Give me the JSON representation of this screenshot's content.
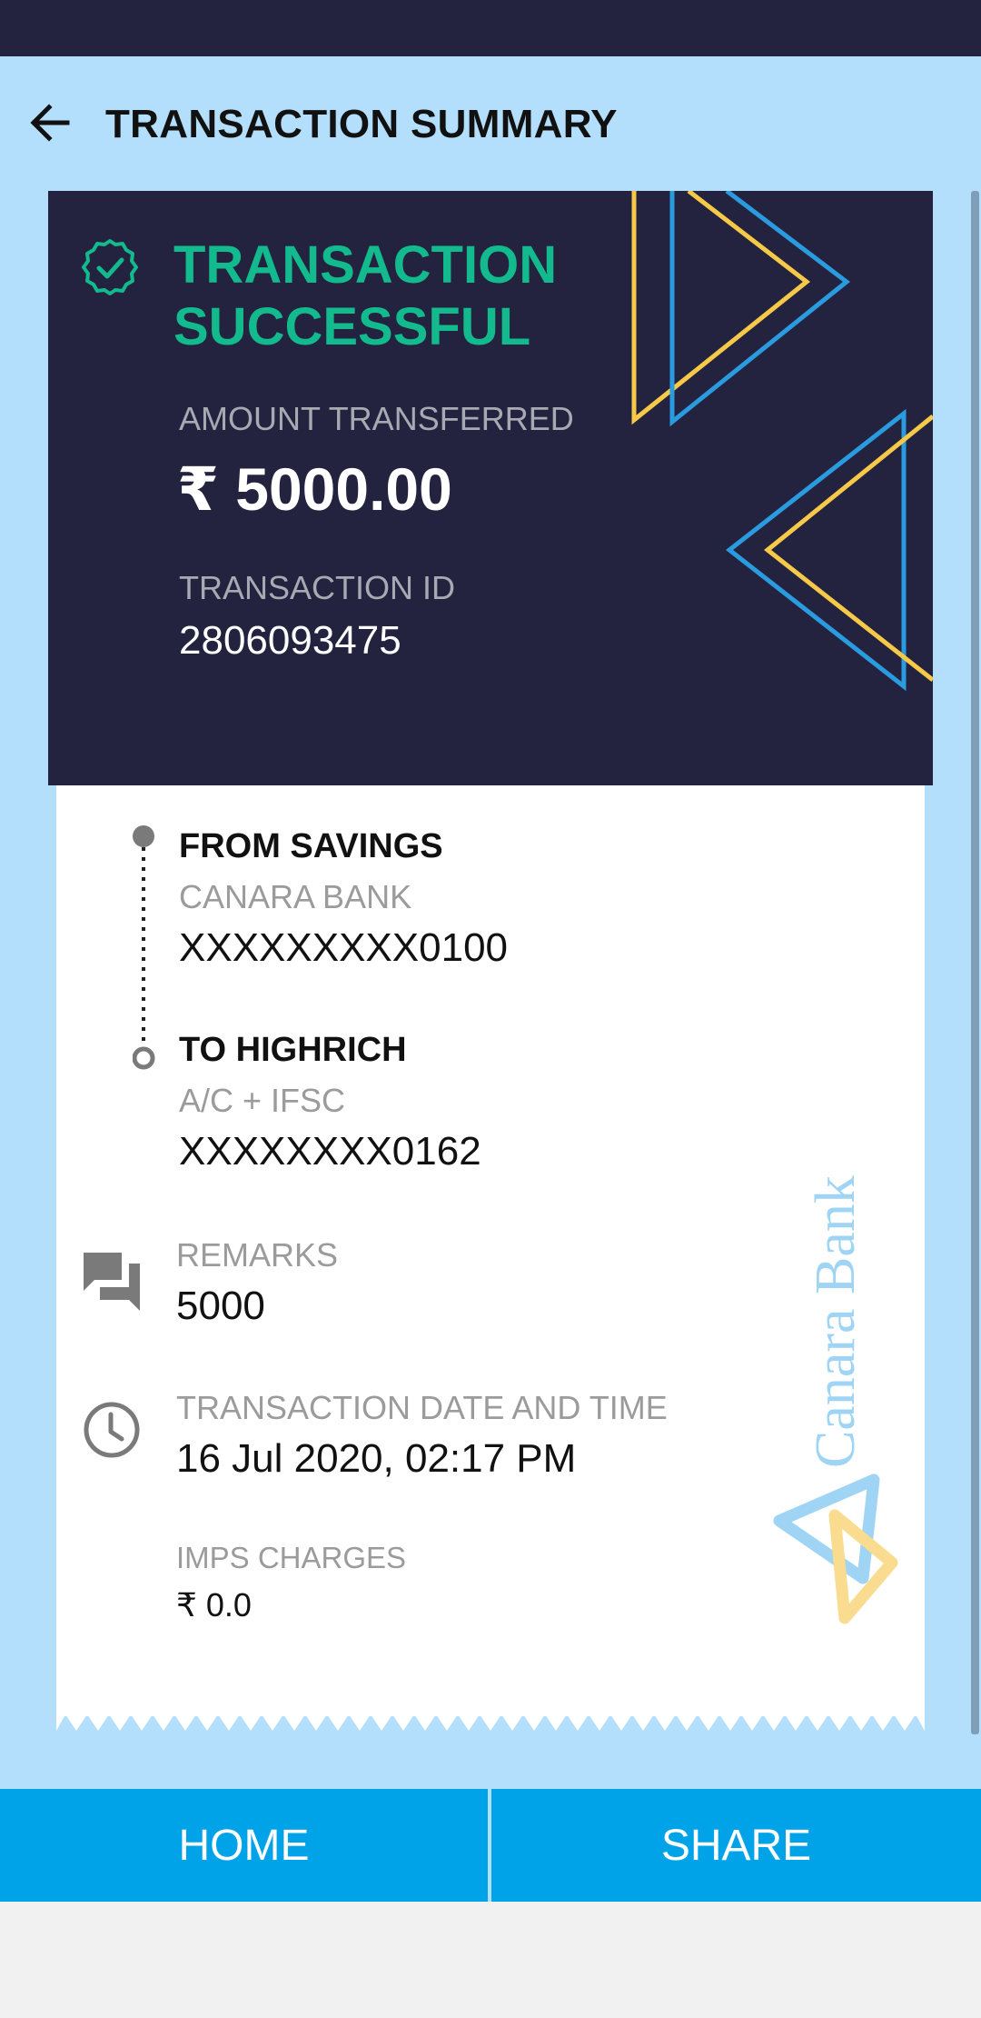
{
  "header": {
    "title": "TRANSACTION SUMMARY"
  },
  "success_card": {
    "status": "TRANSACTION SUCCESSFUL",
    "amount_label": "AMOUNT TRANSFERRED",
    "amount": "₹ 5000.00",
    "txn_id_label": "TRANSACTION ID",
    "txn_id": "2806093475"
  },
  "details": {
    "from_heading": "FROM SAVINGS",
    "from_bank": "CANARA BANK",
    "from_account": "XXXXXXXXX0100",
    "to_heading": "TO HIGHRICH",
    "to_type": "A/C + IFSC",
    "to_account": "XXXXXXXX0162",
    "remarks_label": "REMARKS",
    "remarks": "5000",
    "datetime_label": "TRANSACTION DATE AND TIME",
    "datetime": "16 Jul 2020, 02:17 PM",
    "charges_label": "IMPS CHARGES",
    "charges": "₹ 0.0"
  },
  "watermark": {
    "text": "Canara Bank"
  },
  "buttons": {
    "home": "HOME",
    "share": "SHARE"
  },
  "colors": {
    "background": "#b3dffd",
    "card": "#23233f",
    "success_green": "#12ba8d",
    "accent_blue": "#00a2e8",
    "decor_yellow": "#f7c948",
    "decor_blue": "#2b9be0"
  },
  "icons": {
    "back": "arrow-left-icon",
    "success": "check-circle-icon",
    "remarks": "chat-bubbles-icon",
    "datetime": "clock-icon"
  }
}
